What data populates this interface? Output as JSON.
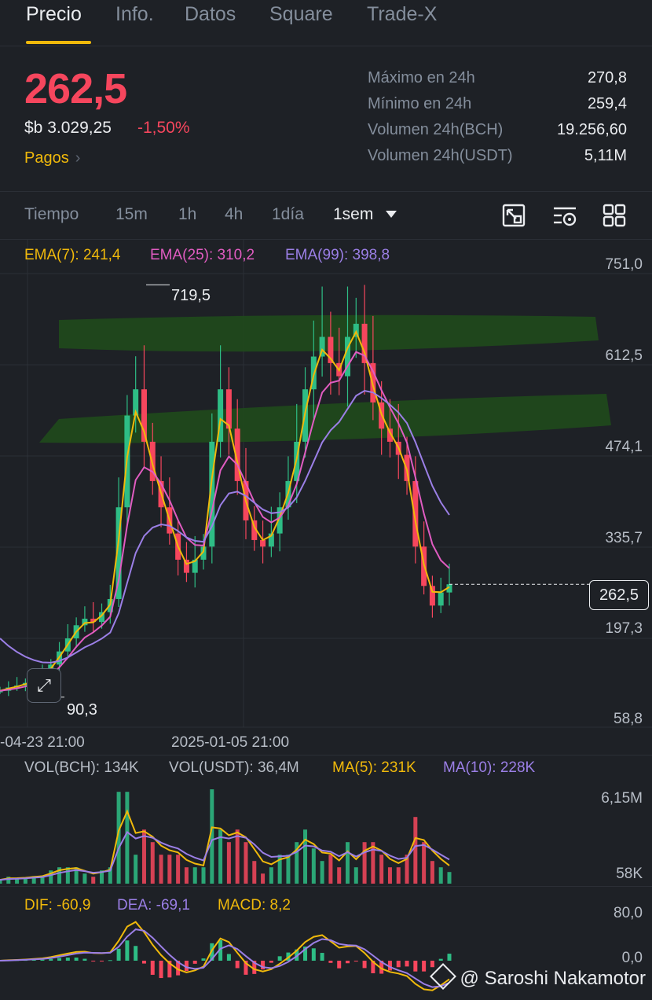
{
  "tabs": [
    {
      "label": "Precio",
      "active": true
    },
    {
      "label": "Info."
    },
    {
      "label": "Datos"
    },
    {
      "label": "Square"
    },
    {
      "label": "Trade-X"
    }
  ],
  "ticker": {
    "last_price": "262,5",
    "fiat_price": "$b 3.029,25",
    "change_pct": "-1,50%",
    "payments_link": "Pagos"
  },
  "stats": [
    {
      "label": "Máximo en 24h",
      "value": "270,8"
    },
    {
      "label": "Mínimo en 24h",
      "value": "259,4"
    },
    {
      "label": "Volumen 24h(BCH)",
      "value": "19.256,60"
    },
    {
      "label": "Volumen 24h(USDT)",
      "value": "5,11M"
    }
  ],
  "timeframes": {
    "label": "Tiempo",
    "options": [
      "15m",
      "1h",
      "4h",
      "1día",
      "1sem"
    ],
    "selected": "1sem"
  },
  "toolbar_icons": [
    "chart-type-icon",
    "indicator-settings-icon",
    "grid-layout-icon"
  ],
  "indicators": {
    "ema7": "EMA(7): 241,4",
    "ema25": "EMA(25): 310,2",
    "ema99": "EMA(99): 398,8"
  },
  "price_axis": [
    "751,0",
    "612,5",
    "474,1",
    "335,7",
    "197,3",
    "58,8"
  ],
  "current_price_tag": "262,5",
  "high_marker": "719,5",
  "low_marker": "90,3",
  "time_axis": [
    "-04-23 21:00",
    "2025-01-05 21:00"
  ],
  "volume": {
    "vol_base": "VOL(BCH): 134K",
    "vol_quote": "VOL(USDT): 36,4M",
    "ma5": "MA(5): 231K",
    "ma10": "MA(10): 228K",
    "axis_top": "6,15M",
    "axis_bottom": "58K"
  },
  "macd": {
    "dif": "DIF: -60,9",
    "dea": "DEA: -69,1",
    "macd": "MACD: 8,2",
    "axis_top": "80,0",
    "axis_zero": "0,0"
  },
  "watermark": "@ Saroshi Nakamotor",
  "colors": {
    "up": "#2ebd85",
    "down": "#f6465d",
    "ema7": "#f0b90b",
    "ema25": "#e05cc1",
    "ema99": "#9b7fe6",
    "accent": "#f0b90b",
    "highlight_band": "#1f4a1c"
  },
  "chart_data": {
    "type": "candlestick",
    "interval": "1sem",
    "ylim": [
      58.8,
      751.0
    ],
    "series": [
      {
        "name": "EMA(7)",
        "last": 241.4
      },
      {
        "name": "EMA(25)",
        "last": 310.2
      },
      {
        "name": "EMA(99)",
        "last": 398.8
      }
    ],
    "close_samples": [
      100,
      105,
      108,
      112,
      118,
      125,
      140,
      160,
      180,
      200,
      210,
      205,
      220,
      240,
      380,
      520,
      560,
      480,
      420,
      380,
      340,
      300,
      280,
      300,
      320,
      480,
      560,
      500,
      420,
      360,
      330,
      320,
      340,
      380,
      420,
      480,
      560,
      610,
      640,
      600,
      580,
      640,
      660,
      600,
      540,
      500,
      480,
      460,
      420,
      320,
      260,
      230,
      250,
      262.5
    ],
    "high": 719.5,
    "low": 90.3,
    "last": 262.5
  }
}
